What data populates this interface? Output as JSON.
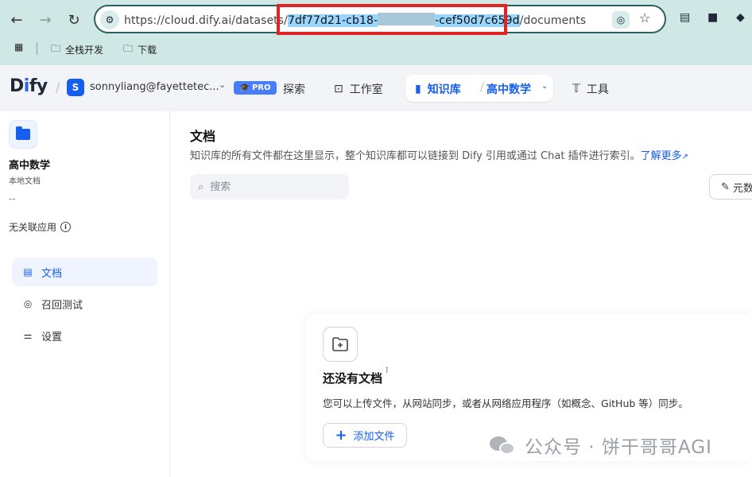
{
  "browser": {
    "url_prefix": "https://cloud.dify.ai/datasets/",
    "url_id_start": "7df77d21-cb18-",
    "url_id_end": "-cef50d7c659d",
    "url_suffix": "/documents",
    "bookmarks": [
      {
        "label": "全栈开发"
      },
      {
        "label": "下载"
      }
    ]
  },
  "topbar": {
    "logo_d": "D",
    "logo_i": "i",
    "logo_fy": "fy",
    "workspace_initial": "S",
    "workspace_name": "sonnyliang@fayettetec...",
    "plan_badge": "PRO",
    "nav_explore": "探索",
    "nav_studio": "工作室",
    "nav_knowledge": "知识库",
    "nav_dataset": "高中数学",
    "nav_tools": "工具"
  },
  "sidebar": {
    "dataset_name": "高中数学",
    "dataset_type": "本地文档",
    "dataset_desc": "--",
    "unrelated_apps": "无关联应用",
    "menu": [
      {
        "label": "文档"
      },
      {
        "label": "召回测试"
      },
      {
        "label": "设置"
      }
    ]
  },
  "main": {
    "title": "文档",
    "description": "知识库的所有文件都在这里显示，整个知识库都可以链接到 Dify 引用或通过 Chat 插件进行索引。",
    "learn_more": "了解更多",
    "search_placeholder": "搜索",
    "metadata_button": "元数",
    "empty_title": "还没有文档",
    "empty_desc": "您可以上传文件，从网站同步，或者从网络应用程序（如概念、GitHub 等）同步。",
    "add_file": "添加文件"
  },
  "watermark": {
    "text": "公众号 · 饼干哥哥AGI"
  }
}
